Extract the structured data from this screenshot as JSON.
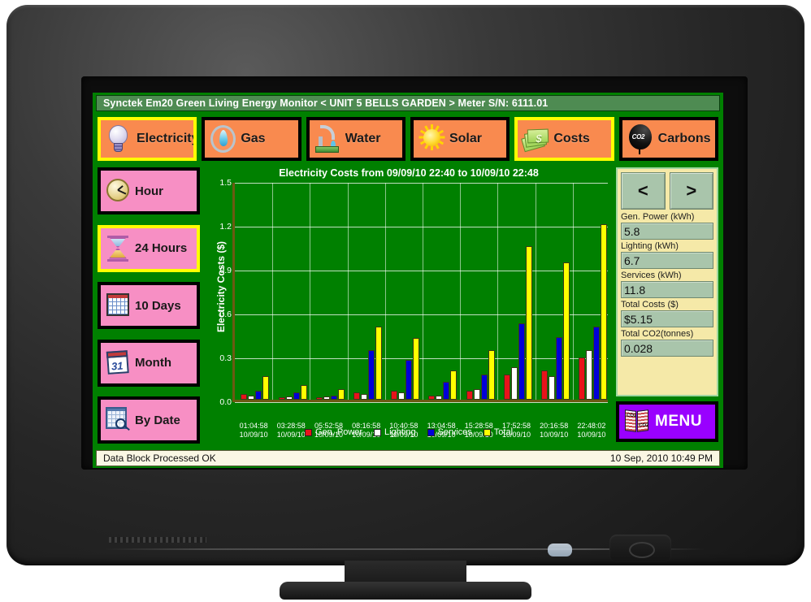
{
  "titlebar": {
    "text": "Synctek Em20 Green Living Energy Monitor < UNIT 5 BELLS GARDEN > Meter S/N: 6111.01"
  },
  "topnav": [
    {
      "label": "Electricity",
      "icon": "lightbulb-icon",
      "selected": true
    },
    {
      "label": "Gas",
      "icon": "flame-icon",
      "selected": false
    },
    {
      "label": "Water",
      "icon": "tap-icon",
      "selected": false
    },
    {
      "label": "Solar",
      "icon": "sun-icon",
      "selected": false
    },
    {
      "label": "Costs",
      "icon": "money-icon",
      "selected": true
    },
    {
      "label": "Carbons",
      "icon": "co2-balloon-icon",
      "selected": false
    }
  ],
  "sidebar": [
    {
      "label": "Hour",
      "icon": "clock-icon",
      "selected": false
    },
    {
      "label": "24 Hours",
      "icon": "hourglass-icon",
      "selected": true
    },
    {
      "label": "10 Days",
      "icon": "calendar-grid-icon",
      "selected": false
    },
    {
      "label": "Month",
      "icon": "calendar-month-icon",
      "selected": false
    },
    {
      "label": "By Date",
      "icon": "calendar-search-icon",
      "selected": false
    }
  ],
  "rightpanel": {
    "prev_label": "<",
    "next_label": ">",
    "readouts": [
      {
        "label": "Gen. Power (kWh)",
        "value": "5.8"
      },
      {
        "label": "Lighting (kWh)",
        "value": "6.7"
      },
      {
        "label": "Services (kWh)",
        "value": "11.8"
      },
      {
        "label": "Total Costs ($)",
        "value": "$5.15"
      },
      {
        "label": "Total CO2(tonnes)",
        "value": "0.028"
      }
    ],
    "menu_label": "MENU",
    "menu_icon": "book-icon"
  },
  "statusbar": {
    "message": "Data Block Processed OK",
    "datetime": "10 Sep, 2010 10:49 PM"
  },
  "colors": {
    "screen_bg": "#008000",
    "titlebar_bg": "#4e8b52",
    "nav_button_bg": "#f98a4f",
    "side_button_bg": "#f78fc4",
    "selected_border": "#ffff00",
    "menu_bg": "#9900ff",
    "readout_panel_bg": "#f5e9a8",
    "readout_field_bg": "#a9c5ab",
    "gen_power": "#e8131a",
    "lighting": "#ffffff",
    "services": "#0000d8",
    "total": "#ffff00"
  },
  "chart_data": {
    "type": "bar",
    "title": "Electricity Costs from 09/09/10 22:40 to 10/09/10 22:48",
    "xlabel": "",
    "ylabel": "Electricity Costs ($)",
    "ylim": [
      0.0,
      1.5
    ],
    "yticks": [
      "0.0",
      "0.3",
      "0.6",
      "0.9",
      "1.2",
      "1.5"
    ],
    "ytick_values": [
      0.0,
      0.3,
      0.6,
      0.9,
      1.2,
      1.5
    ],
    "grid": true,
    "legend_position": "bottom",
    "categories": [
      "01:04:58\n10/09/10",
      "03:28:58\n10/09/10",
      "05:52:58\n10/09/10",
      "08:16:58\n10/09/10",
      "10:40:58\n10/09/10",
      "13:04:58\n10/09/10",
      "15:28:58\n10/09/10",
      "17:52:58\n10/09/10",
      "20:16:58\n10/09/10",
      "22:48:02\n10/09/10"
    ],
    "category_times": [
      "01:04:58",
      "03:28:58",
      "05:52:58",
      "08:16:58",
      "10:40:58",
      "13:04:58",
      "15:28:58",
      "17:52:58",
      "20:16:58",
      "22:48:02"
    ],
    "category_dates": [
      "10/09/10",
      "10/09/10",
      "10/09/10",
      "10/09/10",
      "10/09/10",
      "10/09/10",
      "10/09/10",
      "10/09/10",
      "10/09/10",
      "10/09/10"
    ],
    "series": [
      {
        "name": "Gen. Power",
        "color": "#e8131a",
        "values": [
          0.04,
          0.01,
          0.01,
          0.05,
          0.06,
          0.03,
          0.06,
          0.17,
          0.2,
          0.29
        ]
      },
      {
        "name": "Lighting",
        "color": "#ffffff",
        "values": [
          0.03,
          0.02,
          0.02,
          0.04,
          0.05,
          0.03,
          0.07,
          0.22,
          0.16,
          0.34
        ]
      },
      {
        "name": "Services",
        "color": "#0000d8",
        "values": [
          0.06,
          0.05,
          0.03,
          0.34,
          0.27,
          0.12,
          0.17,
          0.52,
          0.43,
          0.5
        ]
      },
      {
        "name": "Total",
        "color": "#ffff00",
        "values": [
          0.16,
          0.1,
          0.07,
          0.5,
          0.42,
          0.2,
          0.34,
          1.05,
          0.94,
          1.2
        ]
      }
    ]
  }
}
